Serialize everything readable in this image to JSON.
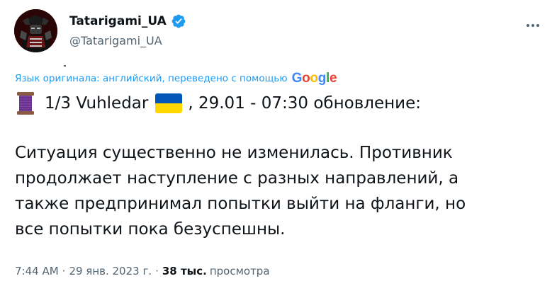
{
  "author": {
    "display_name": "Tatarigami_UA",
    "handle": "@Tatarigami_UA",
    "verified": true,
    "verified_color": "#1d9bf0"
  },
  "translation": {
    "note": "Язык оригинала: английский, переведено с помощью",
    "provider_letters": [
      "G",
      "o",
      "o",
      "g",
      "l",
      "e"
    ],
    "provider_colors": [
      "#4285f4",
      "#ea4335",
      "#fbbc05",
      "#4285f4",
      "#34a853",
      "#ea4335"
    ]
  },
  "tweet": {
    "line1_prefix": "1/3 Vuhledar",
    "line1_suffix": ", 29.01 - 07:30 обновление:",
    "body_lines": [
      "Ситуация существенно не изменилась. Противник",
      "продолжает наступление с разных направлений, а",
      "также предпринимал попытки выйти на фланги, но",
      "все попытки пока безуспешны."
    ],
    "emoji": {
      "thread": "thread-spool-icon",
      "flag": "ukraine-flag-icon",
      "flag_colors": [
        "#0057b7",
        "#ffd700"
      ]
    }
  },
  "meta": {
    "time": "7:44 AM",
    "separator": "·",
    "date": "29 янв. 2023 г.",
    "views_count": "38 тыс.",
    "views_label": "просмотра"
  },
  "colors": {
    "text": "#0f1419",
    "secondary": "#536471",
    "accent": "#1d9bf0"
  },
  "icons": {
    "more": "more-horizontal-icon",
    "verified": "verified-badge-icon"
  }
}
